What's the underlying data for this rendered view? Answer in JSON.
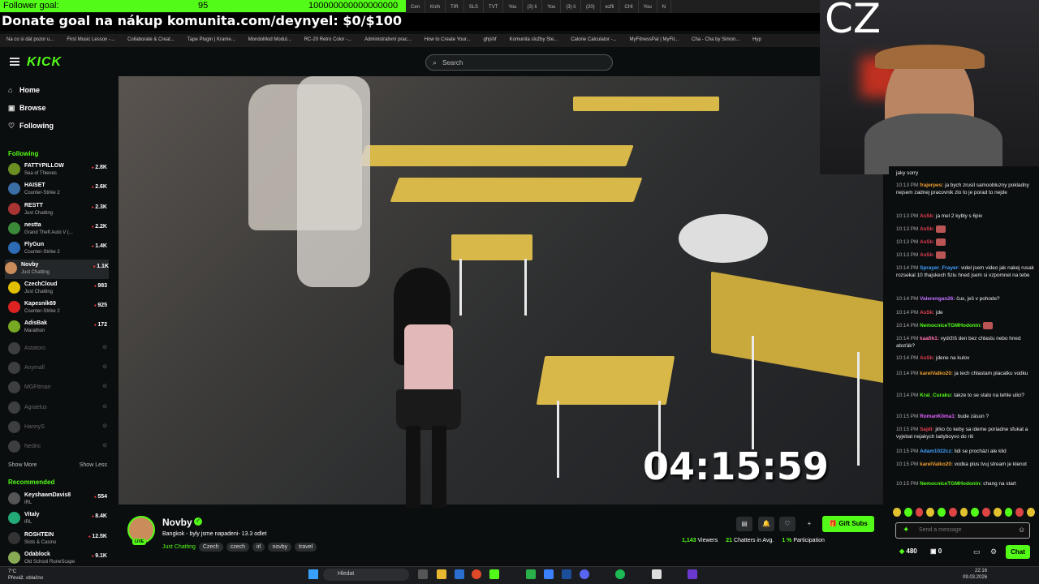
{
  "overlay": {
    "follower_goal_label": "Follower goal:",
    "follower_goal_value": "95",
    "follower_goal_target": "100000000000000000",
    "donate_text": "Donate goal na nákup komunita.com/deynyel: $0/$100",
    "cam_text": "CZ"
  },
  "browser": {
    "tabs": [
      "Cen",
      "Knih",
      "TIR",
      "SLS",
      "TVT",
      "You",
      "(3) li",
      "You",
      "(3) li",
      "(20)",
      "ezfli",
      "CHI",
      "You",
      "N"
    ],
    "bookmarks": [
      "Na co si dát pozor u...",
      "First Music Lesson -...",
      "Collaborate & Creat...",
      "Tape Plugin | Krame...",
      "MondoMod Modul...",
      "RC-20 Retro Color -...",
      "Administrativní prac...",
      "How to Create Your...",
      "ghjshf",
      "Komunita služby Ste...",
      "Calorie Calculator -...",
      "MyFitnessPal | MyFit...",
      "Cha - Cha by Simon...",
      "Hyp"
    ]
  },
  "kick": {
    "logo": "KICK",
    "search_placeholder": "Search",
    "nav": {
      "home": "Home",
      "browse": "Browse",
      "following": "Following"
    },
    "following_title": "Following",
    "recommended_title": "Recommended",
    "show_more": "Show More",
    "show_less": "Show Less",
    "following_channels": [
      {
        "name": "FATTYPILLOW",
        "game": "Sea of Thieves",
        "viewers": "2.8K",
        "color": "#6b8e23"
      },
      {
        "name": "HAISET",
        "game": "Counter-Strike 2",
        "viewers": "2.6K",
        "color": "#3a6ea5"
      },
      {
        "name": "RESTT",
        "game": "Just Chatting",
        "viewers": "2.3K",
        "color": "#a33"
      },
      {
        "name": "nestta",
        "game": "Grand Theft Auto V (...",
        "viewers": "2.2K",
        "color": "#3a8a3a"
      },
      {
        "name": "FlyGun",
        "game": "Counter-Strike 2",
        "viewers": "1.4K",
        "color": "#2d6bb5"
      },
      {
        "name": "Novby",
        "game": "Just Chatting",
        "viewers": "1.1K",
        "color": "#c98c5a"
      },
      {
        "name": "CzechCloud",
        "game": "Just Chatting",
        "viewers": "983",
        "color": "#e0c000"
      },
      {
        "name": "Kapesnik69",
        "game": "Counter-Strike 2",
        "viewers": "925",
        "color": "#d22"
      },
      {
        "name": "AdisBak",
        "game": "Marathon",
        "viewers": "172",
        "color": "#7a2"
      }
    ],
    "offline_channels": [
      "Astatoro",
      "Anymall",
      "MGFitman",
      "Agraelus",
      "HannyS",
      "Nedric"
    ],
    "recommended_channels": [
      {
        "name": "KeyshawnDavis8",
        "game": "IRL",
        "viewers": "554",
        "color": "#555"
      },
      {
        "name": "Vitaly",
        "game": "IRL",
        "viewers": "8.4K",
        "color": "#2a7"
      },
      {
        "name": "ROSHTEIN",
        "game": "Slots & Casino",
        "viewers": "12.5K",
        "color": "#333"
      },
      {
        "name": "Odablock",
        "game": "Old School RuneScape",
        "viewers": "9.1K",
        "color": "#8a5"
      }
    ],
    "timer": "04:15:59",
    "stream": {
      "name": "Novby",
      "live": "LIVE",
      "title": "Bangkok - byly jsme napadeni- 13.3 odlet",
      "category": "Just Chatting",
      "tags": [
        "Czech",
        "czech",
        "irl",
        "novby",
        "travel"
      ],
      "gift_subs": "Gift Subs",
      "viewers": "1,143",
      "viewers_label": "Viewers",
      "chatters": "21",
      "chatters_label": "Chatters in Avg.",
      "participation": "1 %",
      "participation_label": "Participation"
    },
    "chat": {
      "messages": [
        {
          "time": "",
          "user": "",
          "color": "#888",
          "text": "jaky sorry"
        },
        {
          "time": "10:13 PM",
          "user": "frajerpes:",
          "color": "#f0a030",
          "text": "ja bych zrusil samoobluzny pokladny nejsem zadnej pracovnik zlo to je porad to nejde"
        },
        {
          "time": "10:13 PM",
          "user": "AsSk:",
          "color": "#e04050",
          "text": "ja mel 2 kybly s 6piv"
        },
        {
          "time": "10:13 PM",
          "user": "AsSk:",
          "color": "#e04050",
          "text": ""
        },
        {
          "time": "10:13 PM",
          "user": "AsSk:",
          "color": "#e04050",
          "text": ""
        },
        {
          "time": "10:13 PM",
          "user": "AsSk:",
          "color": "#e04050",
          "text": ""
        },
        {
          "time": "10:14 PM",
          "user": "Sprayer_Frayer:",
          "color": "#40a0ff",
          "text": "videl jsem video jak nakej rusak rozsekal 10 thajskech fiziu hned jsem si vzpomnel na tebe"
        },
        {
          "time": "10:14 PM",
          "user": "Valerengan26:",
          "color": "#c070ff",
          "text": "čus, ješ v pohode?"
        },
        {
          "time": "10:14 PM",
          "user": "AsSk:",
          "color": "#e04050",
          "text": "jde"
        },
        {
          "time": "10:14 PM",
          "user": "NemocniceTGMHodonin:",
          "color": "#53fc18",
          "text": ""
        },
        {
          "time": "10:14 PM",
          "user": "kaafik1:",
          "color": "#ff70b0",
          "text": "vydržíš den bez chlastu nebo hned absťák?"
        },
        {
          "time": "10:14 PM",
          "user": "AsSk:",
          "color": "#e04050",
          "text": "jdene na kulov"
        },
        {
          "time": "10:14 PM",
          "user": "karelValko20:",
          "color": "#f0a030",
          "text": "ja tech chlastam placatku vodku"
        },
        {
          "time": "10:14 PM",
          "user": "Kral_Curaku:",
          "color": "#53fc18",
          "text": "takze to se stalo na tehle ulici?"
        },
        {
          "time": "10:15 PM",
          "user": "RomanKlima1:",
          "color": "#e060ff",
          "text": "bude zásun ?"
        },
        {
          "time": "10:15 PM",
          "user": "Sajdi:",
          "color": "#e04050",
          "text": "jirko čo keby sa ideme poriadne sfukat a vyjebat nejakych ladyboyvo do riti"
        },
        {
          "time": "10:15 PM",
          "user": "Adam1022cz:",
          "color": "#40a0ff",
          "text": "lidi se procházi ale klid"
        },
        {
          "time": "10:15 PM",
          "user": "karelValko20:",
          "color": "#f0a030",
          "text": "vodka plus tvuj stream je klenot"
        },
        {
          "time": "10:15 PM",
          "user": "NemocniceTGMHodonin:",
          "color": "#53fc18",
          "text": "chang na start"
        }
      ],
      "input_placeholder": "Send a message",
      "points": "480",
      "gifts": "0",
      "chat_button": "Chat"
    }
  },
  "taskbar": {
    "temp": "7°C",
    "weather": "Převáž. oblačno",
    "search": "Hledat",
    "time": "22:16",
    "date": "09.03.2026"
  },
  "colors": {
    "accent": "#53fc18",
    "bg": "#0b0e0f"
  }
}
